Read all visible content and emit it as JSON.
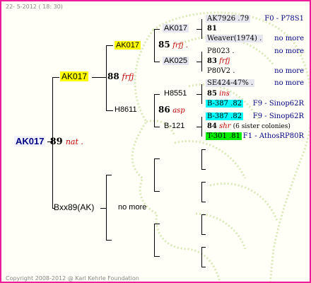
{
  "header": {
    "date": "22-  5-2012 ( 18: 30)"
  },
  "footer": {
    "copyright": "Copyright 2008-2012 @ Karl Kehrle Foundation"
  },
  "root": {
    "name": "AK017",
    "score": "89",
    "desc": "nat ."
  },
  "gen1": {
    "sire": {
      "name": "AK017",
      "score": "88",
      "desc": "frfj"
    },
    "dam": {
      "name": "Bxx89(AK)",
      "note": "no more"
    }
  },
  "gen2": {
    "ss": {
      "name": "AK017",
      "score": "85",
      "desc": "frfj ."
    },
    "sd": {
      "name": "H8611",
      "score": "86",
      "desc": "asp"
    }
  },
  "gen3": {
    "sss": {
      "name": "AK017"
    },
    "ssd": {
      "name": "AK025"
    },
    "sds": {
      "name": "H8551"
    },
    "sdd": {
      "name": "B-121"
    }
  },
  "gen4": [
    {
      "name": "AK7926 .79",
      "right": "F0 - P78S1"
    },
    {
      "score": "81"
    },
    {
      "name": "Weaver(1974) .",
      "right": "no more"
    },
    {
      "name": "P8023 .",
      "right": "no more"
    },
    {
      "score": "83",
      "desc": "frfj"
    },
    {
      "name": "P80V2 .",
      "right": "no more"
    },
    {
      "name": "SE424-47% .",
      "right": "no more"
    },
    {
      "score": "85",
      "desc": "ins"
    },
    {
      "name": "B-387 .82",
      "right": "F9 - Sinop62R"
    },
    {
      "name": "B-387 .82",
      "right": "F9 - Sinop62R"
    },
    {
      "score": "84",
      "desc": "shr",
      "note": "(6 sister colonies)"
    },
    {
      "name": "T-301 .81",
      "right": "F1 - AthosRP80R"
    }
  ]
}
